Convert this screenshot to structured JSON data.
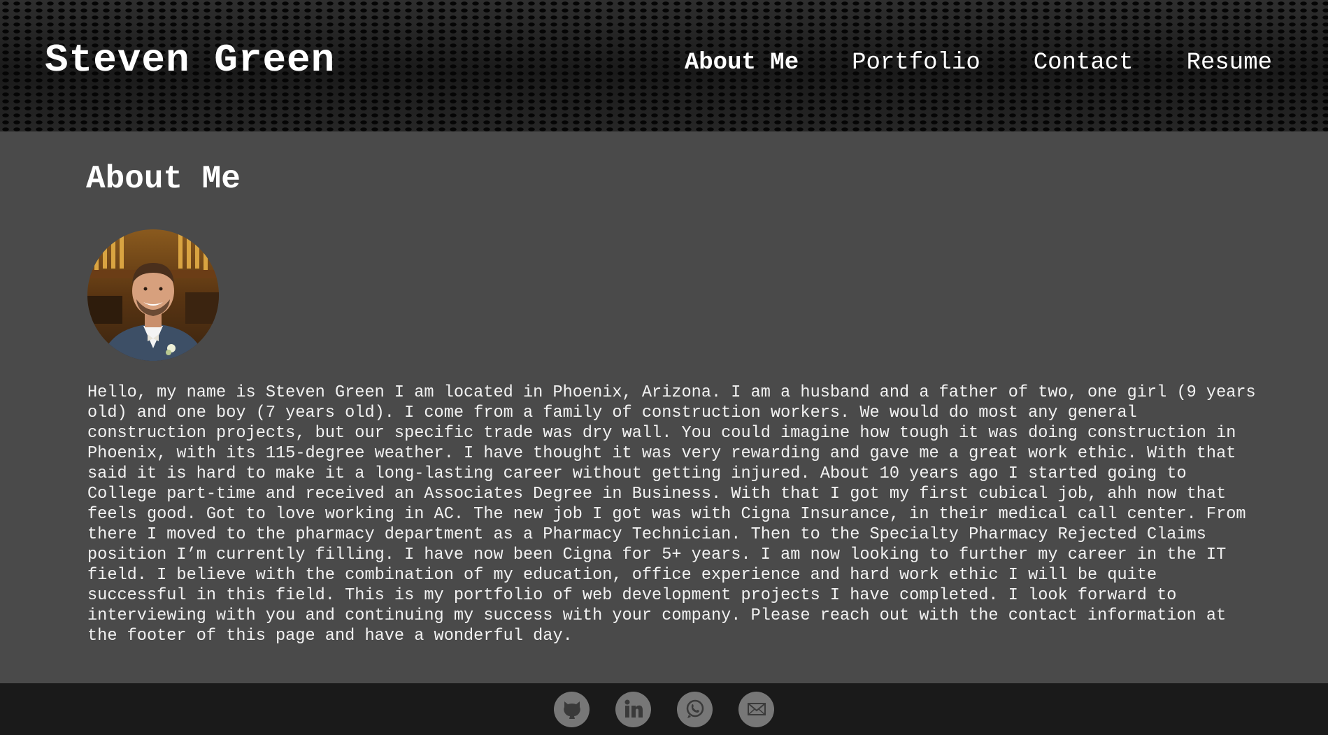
{
  "header": {
    "brand": "Steven Green",
    "nav": [
      {
        "label": "About Me",
        "active": true
      },
      {
        "label": "Portfolio",
        "active": false
      },
      {
        "label": "Contact",
        "active": false
      },
      {
        "label": "Resume",
        "active": false
      }
    ]
  },
  "main": {
    "title": "About Me",
    "avatar_alt": "portrait photo",
    "bio": "Hello, my name is Steven Green I am located in Phoenix, Arizona. I am a husband and a father of two, one girl (9 years old) and one boy (7 years old). I come from a family of construction workers. We would do most any general construction projects, but our specific trade was dry wall. You could imagine how tough it was doing construction in Phoenix, with its 115-degree weather. I have thought it was very rewarding and gave me a great work ethic. With that said it is hard to make it a long-lasting career without getting injured. About 10 years ago I started going to College part-time and received an Associates Degree in Business. With that I got my first cubical job, ahh now that feels good. Got to love working in AC. The new job I got was with Cigna Insurance, in their medical call center. From there I moved to the pharmacy department as a Pharmacy Technician. Then to the Specialty Pharmacy Rejected Claims position I’m currently filling. I have now been Cigna for 5+ years. I am now looking to further my career in the IT field. I believe with the combination of my education, office experience and hard work ethic I will be quite successful in this field. This is my portfolio of web development projects I have completed. I look forward to interviewing with you and continuing my success with your company. Please reach out with the contact information at the footer of this page and have a wonderful day."
  },
  "footer": {
    "icons": [
      "github-icon",
      "linkedin-icon",
      "whatsapp-icon",
      "email-icon"
    ]
  },
  "colors": {
    "background": "#4a4a4a",
    "header": "#1c1c1c",
    "footer": "#1a1a1a",
    "icon_circle": "#777777",
    "text": "#ffffff"
  }
}
